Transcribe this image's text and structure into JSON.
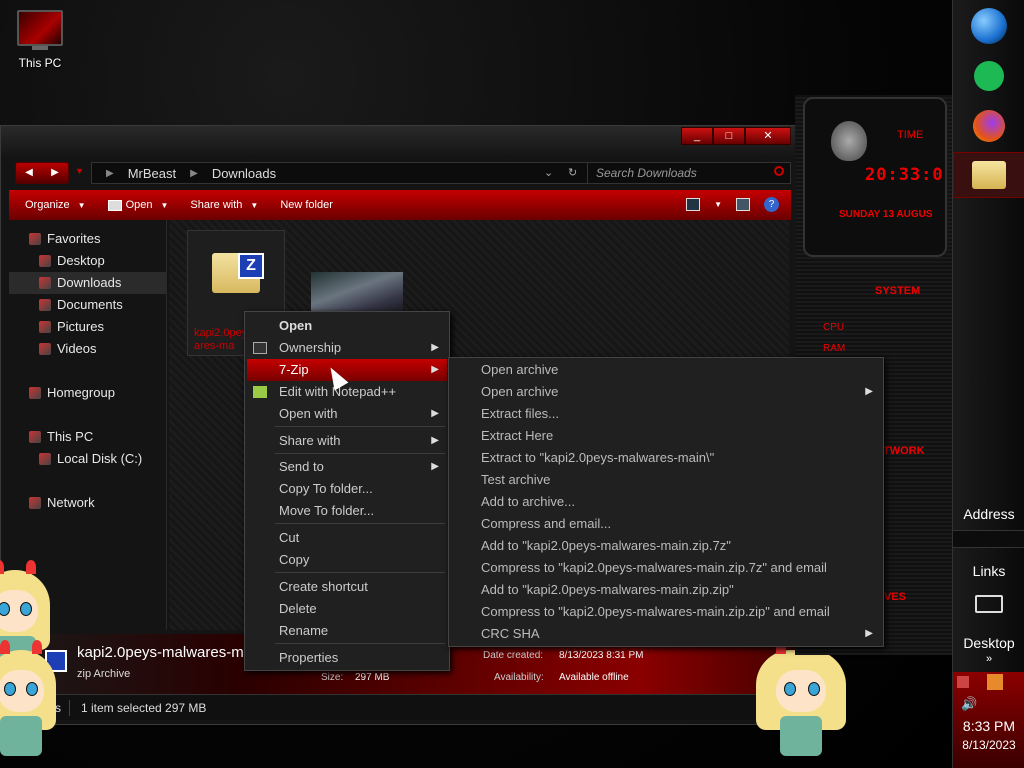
{
  "desktop": {
    "this_pc_label": "This PC"
  },
  "explorer": {
    "nav": {
      "back": "◀",
      "forward": "▶",
      "dropdown": "▼"
    },
    "address": {
      "segments": [
        "MrBeast",
        "Downloads"
      ],
      "separator": "▶",
      "dropdown": "⌄",
      "refresh": "↻"
    },
    "search_placeholder": "Search Downloads",
    "toolbar": {
      "organize": "Organize",
      "open": "Open",
      "share_with": "Share with",
      "new_folder": "New folder",
      "caret": "▼",
      "help": "?"
    },
    "nav_pane": {
      "favorites": "Favorites",
      "desktop": "Desktop",
      "downloads": "Downloads",
      "documents": "Documents",
      "pictures": "Pictures",
      "videos": "Videos",
      "homegroup": "Homegroup",
      "this_pc": "This PC",
      "local_disk": "Local Disk (C:)",
      "network": "Network"
    },
    "files": [
      {
        "name": "kapi2.0peys-malwares-main",
        "visible_fragment": "kapi2.0pey ares-ma"
      }
    ],
    "details": {
      "file_name": "kapi2.0peys-malwares-mai",
      "file_type": "zip Archive",
      "size_label": "Size:",
      "size_value": "297 MB",
      "created_label": "Date created:",
      "created_value": "8/13/2023 8:31 PM",
      "availability_label": "Availability:",
      "availability_value": "Available offline"
    },
    "status": {
      "items_fragment": "ms",
      "selected": "1 item selected  297 MB"
    },
    "window_buttons": {
      "min": "_",
      "max": "□",
      "close": "✕"
    }
  },
  "context_menu": {
    "items": [
      {
        "label": "Open",
        "bold": true
      },
      {
        "label": "Ownership",
        "submenu": true
      },
      {
        "label": "7-Zip",
        "submenu": true,
        "highlighted": true
      },
      {
        "label": "Edit with Notepad++"
      },
      {
        "label": "Open with",
        "submenu": true
      },
      {
        "label": "Share with",
        "submenu": true
      },
      {
        "label": "Send to",
        "submenu": true
      },
      {
        "label": "Copy To folder..."
      },
      {
        "label": "Move To folder..."
      },
      {
        "label": "Cut"
      },
      {
        "label": "Copy"
      },
      {
        "label": "Create shortcut"
      },
      {
        "label": "Delete"
      },
      {
        "label": "Rename"
      },
      {
        "label": "Properties"
      }
    ],
    "arrow": "▶"
  },
  "submenu_7zip": {
    "items": [
      {
        "label": "Open archive"
      },
      {
        "label": "Open archive",
        "submenu": true
      },
      {
        "label": "Extract files..."
      },
      {
        "label": "Extract Here"
      },
      {
        "label": "Extract to \"kapi2.0peys-malwares-main\\\""
      },
      {
        "label": "Test archive"
      },
      {
        "label": "Add to archive..."
      },
      {
        "label": "Compress and email..."
      },
      {
        "label": "Add to \"kapi2.0peys-malwares-main.zip.7z\""
      },
      {
        "label": "Compress to \"kapi2.0peys-malwares-main.zip.7z\" and email"
      },
      {
        "label": "Add to \"kapi2.0peys-malwares-main.zip.zip\""
      },
      {
        "label": "Compress to \"kapi2.0peys-malwares-main.zip.zip\" and email"
      },
      {
        "label": "CRC SHA",
        "submenu": true
      }
    ]
  },
  "gadget": {
    "time_label": "TIME",
    "time": "20:33:0",
    "date": "SUNDAY 13 AUGUS",
    "system_label": "SYSTEM",
    "cpu_label": "CPU",
    "ram_label": "RAM",
    "network_label": "TWORK",
    "drives_label": "RIVES"
  },
  "taskbar": {
    "address_label": "Address",
    "links_label": "Links",
    "desktop_label": "Desktop",
    "chevron": "»",
    "clock": "8:33 PM",
    "date": "8/13/2023",
    "volume": "🔊"
  },
  "colors": {
    "accent": "#c40000",
    "dark": "#141414",
    "text": "#dddddd"
  }
}
